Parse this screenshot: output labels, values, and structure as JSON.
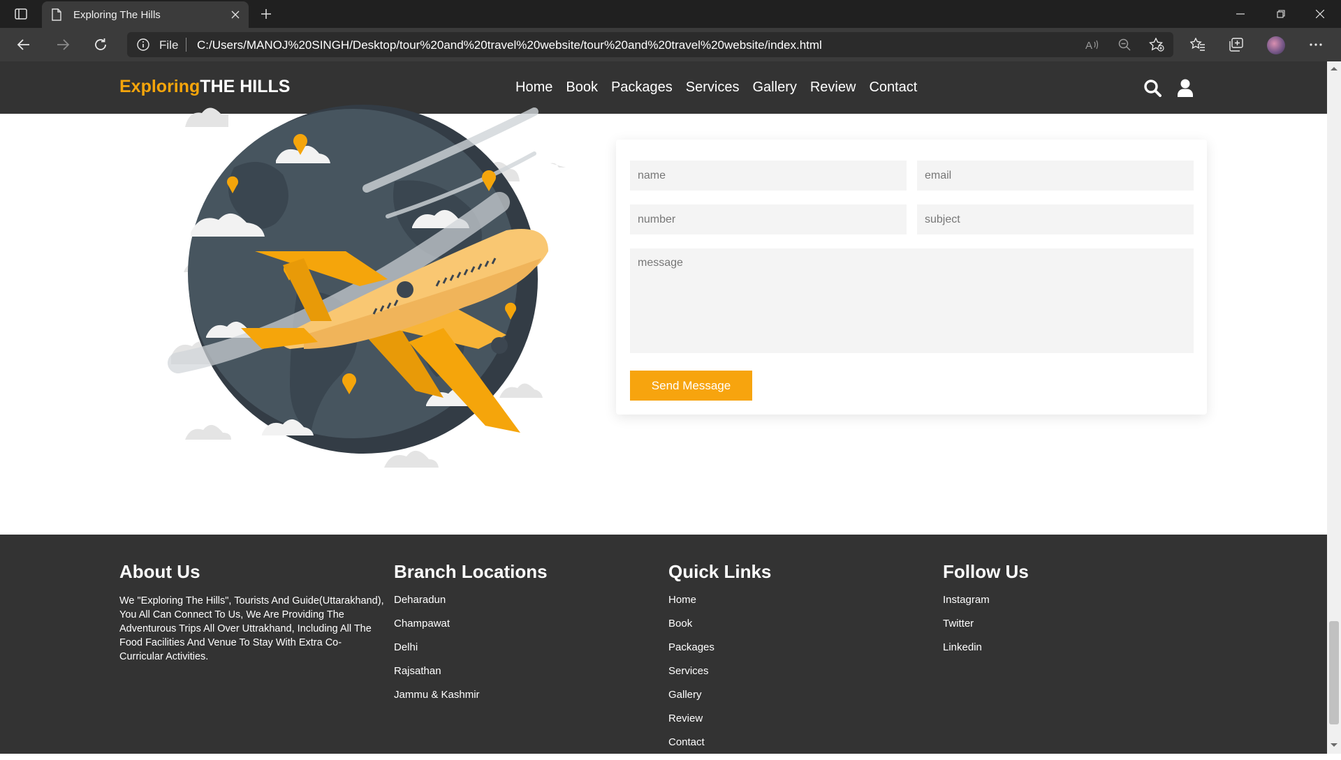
{
  "browser": {
    "tab_title": "Exploring The Hills",
    "address_prefix": "File",
    "url": "C:/Users/MANOJ%20SINGH/Desktop/tour%20and%20travel%20website/tour%20and%20travel%20website/index.html"
  },
  "header": {
    "logo_part1": "Exploring",
    "logo_part2": "THE HILLS",
    "nav": [
      "Home",
      "Book",
      "Packages",
      "Services",
      "Gallery",
      "Review",
      "Contact"
    ]
  },
  "form": {
    "name_placeholder": "name",
    "email_placeholder": "email",
    "number_placeholder": "number",
    "subject_placeholder": "subject",
    "message_placeholder": "message",
    "submit_label": "Send Message"
  },
  "footer": {
    "about": {
      "title": "About Us",
      "text": "We \"Exploring The Hills\", Tourists And Guide(Uttarakhand), You All Can Connect To Us, We Are Providing The Adventurous Trips All Over Uttrakhand, Including All The Food Facilities And Venue To Stay With Extra Co-Curricular Activities."
    },
    "branches": {
      "title": "Branch Locations",
      "items": [
        "Deharadun",
        "Champawat",
        "Delhi",
        "Rajsathan",
        "Jammu & Kashmir"
      ]
    },
    "quick_links": {
      "title": "Quick Links",
      "items": [
        "Home",
        "Book",
        "Packages",
        "Services",
        "Gallery",
        "Review",
        "Contact"
      ]
    },
    "follow": {
      "title": "Follow Us",
      "items": [
        "Instagram",
        "Twitter",
        "Linkedin"
      ]
    }
  },
  "colors": {
    "accent": "#f5a50b",
    "header_bg": "#333333",
    "footer_bg": "#333333",
    "globe": "#47555f"
  }
}
